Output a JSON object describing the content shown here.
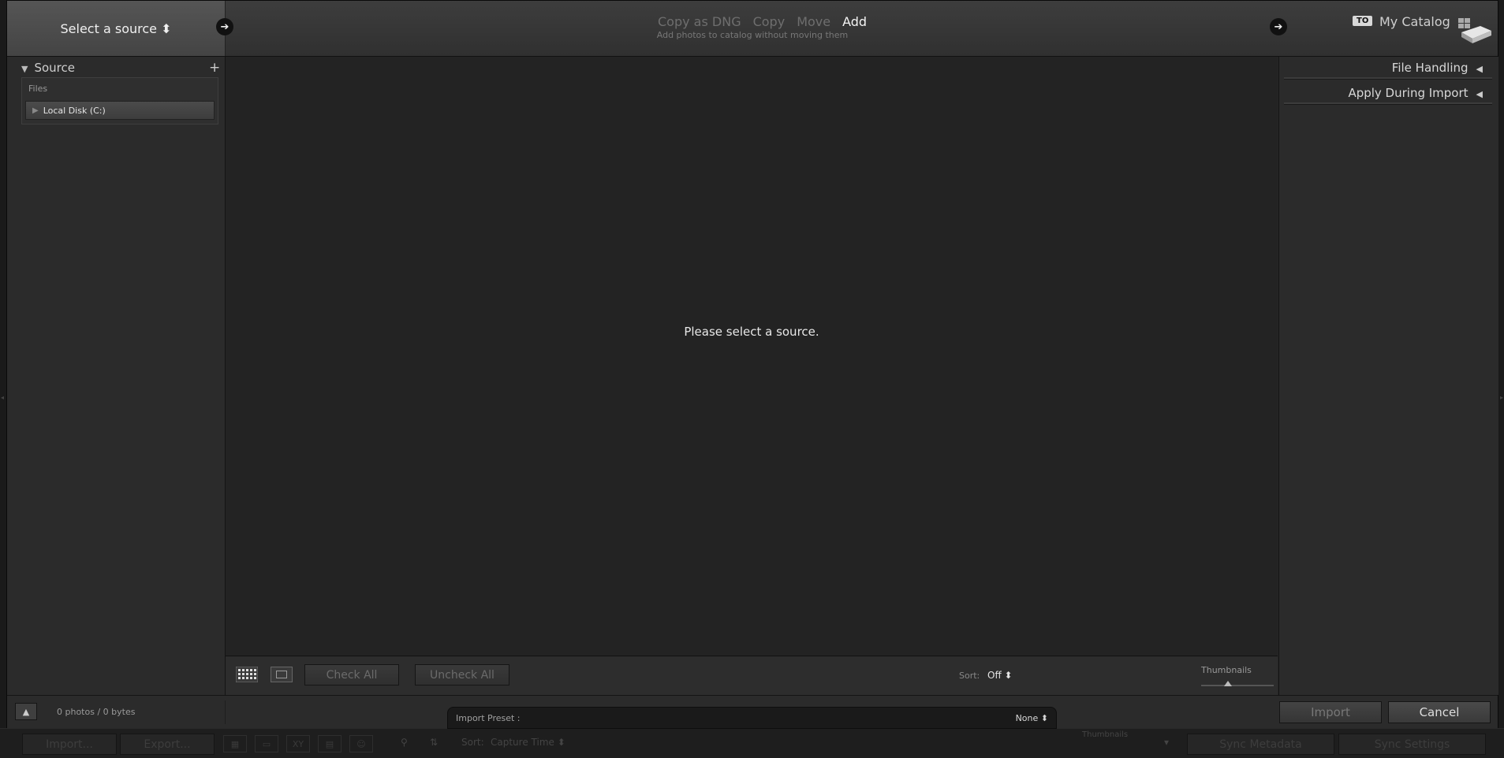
{
  "topbar": {
    "source_button": "Select a source ⬍",
    "modes": [
      {
        "label": "Copy as DNG",
        "active": false
      },
      {
        "label": "Copy",
        "active": false
      },
      {
        "label": "Move",
        "active": false
      },
      {
        "label": "Add",
        "active": true
      }
    ],
    "mode_description": "Add photos to catalog without moving them",
    "to_badge": "TO",
    "catalog_name": "My Catalog"
  },
  "left_panel": {
    "header": "Source",
    "files_label": "Files",
    "disk_label": "Local Disk (C:)"
  },
  "center": {
    "message": "Please select a source."
  },
  "toolbar": {
    "check_all": "Check All",
    "uncheck_all": "Uncheck All",
    "sort_label": "Sort:",
    "sort_value": "Off ⬍",
    "thumbnails_label": "Thumbnails"
  },
  "right_panel": {
    "file_handling": "File Handling",
    "apply_during_import": "Apply During Import"
  },
  "bottombar": {
    "photo_count": "0 photos / 0 bytes",
    "import_button": "Import",
    "cancel_button": "Cancel"
  },
  "preset": {
    "label": "Import Preset :",
    "value": "None ⬍"
  },
  "library_strip": {
    "import": "Import...",
    "export": "Export...",
    "sort_label": "Sort:",
    "sort_value": "Capture Time ⬍",
    "thumbnails": "Thumbnails",
    "sync_metadata": "Sync Metadata",
    "sync_settings": "Sync Settings"
  },
  "colors": {
    "active_mode": "#f4f4f4",
    "inactive_mode": "#6e6e6e",
    "panel_bg": "#2b2b2b",
    "grid_bg": "#232323"
  }
}
